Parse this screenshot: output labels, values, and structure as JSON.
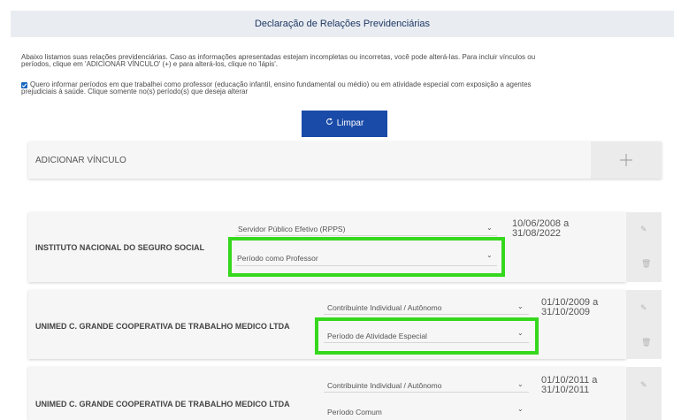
{
  "header": {
    "title": "Declaração de Relações Previdenciárias"
  },
  "intro": {
    "line1": "Abaixo listamos suas relações previdenciárias. Caso as informações apresentadas estejam incompletas ou incorretas, você pode alterá-las. Para incluir vínculos ou",
    "line2": "períodos, clique em 'ADICIONAR VÍNCULO' (+) e para alterá-los, clique no 'lápis'."
  },
  "checkbox": {
    "checked": true,
    "line1": "Quero informar períodos em que trabalhei como professor (educação infantil, ensino fundamental ou médio) ou em atividade especial com exposição a agentes",
    "line2": "prejudiciais à saúde. Clique somente no(s) período(s) que deseja alterar"
  },
  "buttons": {
    "limpar": "Limpar"
  },
  "add_vinculo": {
    "label": "ADICIONAR VÍNCULO"
  },
  "vinculos": [
    {
      "employer": "INSTITUTO NACIONAL DO SEGURO SOCIAL",
      "type": "Servidor Público Efetivo (RPPS)",
      "period": "Período como Professor",
      "date_start": "10/06/2008 a",
      "date_end": "31/08/2022"
    },
    {
      "employer": "UNIMED C. GRANDE COOPERATIVA DE TRABALHO MEDICO LTDA",
      "type": "Contribuinte Individual / Autônomo",
      "period": "Período de Atividade Especial",
      "date_start": "01/10/2009 a",
      "date_end": "31/10/2009"
    },
    {
      "employer": "UNIMED C. GRANDE COOPERATIVA DE TRABALHO MEDICO LTDA",
      "type": "Contribuinte Individual / Autônomo",
      "period": "Período Comum",
      "date_start": "01/10/2011 a",
      "date_end": "31/10/2011"
    }
  ],
  "colors": {
    "header_bg": "#e9edf2",
    "primary": "#1a4ba8",
    "highlight": "#35d81c"
  },
  "icons": {
    "refresh": "refresh-icon",
    "plus": "plus-icon",
    "chevron": "chevron-down-icon",
    "edit": "pencil-icon",
    "delete": "trash-icon"
  }
}
